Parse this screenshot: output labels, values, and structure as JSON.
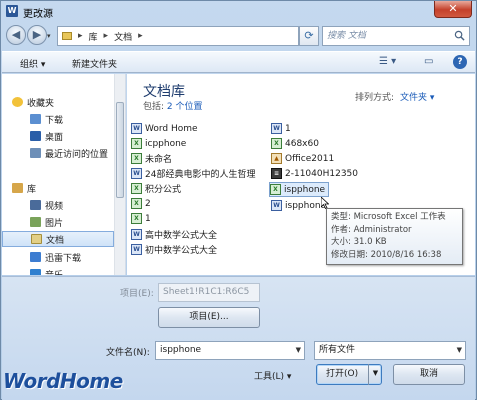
{
  "window": {
    "title": "更改源",
    "app_icon_letter": "W",
    "close_symbol": "✕"
  },
  "nav": {
    "back_symbol": "◀",
    "forward_symbol": "▶",
    "breadcrumb": [
      "库",
      "文档"
    ],
    "search_placeholder": "搜索 文档"
  },
  "toolbar": {
    "organize": "组织 ▾",
    "new_folder": "新建文件夹",
    "help": "?"
  },
  "sidebar": {
    "favorites": {
      "label": "收藏夹",
      "items": [
        {
          "label": "下载",
          "icon": "download-folder-icon"
        },
        {
          "label": "桌面",
          "icon": "desktop-icon"
        },
        {
          "label": "最近访问的位置",
          "icon": "recent-places-icon"
        }
      ]
    },
    "libraries": {
      "label": "库",
      "items": [
        {
          "label": "视频",
          "icon": "video-library-icon"
        },
        {
          "label": "图片",
          "icon": "picture-library-icon"
        },
        {
          "label": "文档",
          "icon": "document-library-icon",
          "selected": true
        },
        {
          "label": "迅雷下载",
          "icon": "thunder-download-icon"
        },
        {
          "label": "音乐",
          "icon": "music-library-icon"
        }
      ]
    }
  },
  "library": {
    "title": "文档库",
    "includes_prefix": "包括:",
    "includes_link": "2 个位置",
    "arrange_label": "排列方式:",
    "arrange_value": "文件夹 ▾"
  },
  "files": {
    "col1": [
      {
        "name": "Word Home",
        "type": "doc"
      },
      {
        "name": "icpphone",
        "type": "xls"
      },
      {
        "name": "未命名",
        "type": "xls"
      },
      {
        "name": "24部经典电影中的人生哲理",
        "type": "doc"
      },
      {
        "name": "积分公式",
        "type": "xls"
      },
      {
        "name": "2",
        "type": "xls"
      },
      {
        "name": "1",
        "type": "xls"
      },
      {
        "name": "高中数学公式大全",
        "type": "doc"
      },
      {
        "name": "初中数学公式大全",
        "type": "doc"
      }
    ],
    "col2": [
      {
        "name": "1",
        "type": "doc"
      },
      {
        "name": "468x60",
        "type": "xls"
      },
      {
        "name": "Office2011",
        "type": "pic"
      },
      {
        "name": "2-11040H12350",
        "type": "lib"
      },
      {
        "name": "ispphone",
        "type": "xls",
        "selected": true
      },
      {
        "name": "ispphone",
        "type": "doc"
      }
    ]
  },
  "tooltip": {
    "type": "类型: Microsoft Excel 工作表",
    "author": "作者: Administrator",
    "size": "大小: 31.0 KB",
    "modified": "修改日期: 2010/8/16 16:38"
  },
  "bottom": {
    "item_label": "项目(E):",
    "item_value": "Sheet1!R1C1:R6C5",
    "item_button": "项目(E)...",
    "filename_label": "文件名(N):",
    "filename_value": "ispphone",
    "filetype_value": "所有文件",
    "tools": "工具(L)",
    "open": "打开(O)",
    "cancel": "取消"
  },
  "watermark": "WordHome"
}
